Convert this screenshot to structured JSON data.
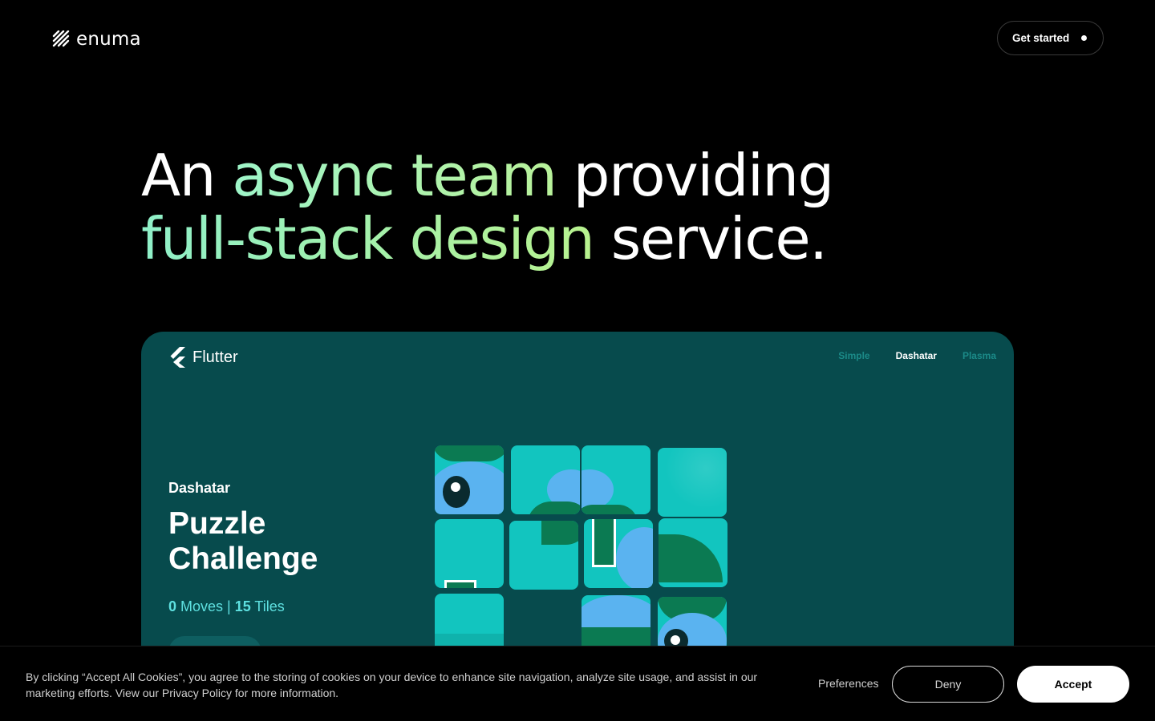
{
  "nav": {
    "logo_text": "enuma",
    "cta_label": "Get started"
  },
  "hero": {
    "line1_a": "An ",
    "line1_b": "async team",
    "line1_c": " providing",
    "line2_a": "full-stack design",
    "line2_b": " service."
  },
  "card": {
    "brand": "Flutter",
    "tabs": [
      "Simple",
      "Dashatar",
      "Plasma"
    ],
    "active_tab": "Dashatar",
    "theme_name": "Dashatar",
    "title": "Puzzle Challenge",
    "moves_count": "0",
    "moves_label": " Moves | ",
    "tiles_count": "15",
    "tiles_label": " Tiles"
  },
  "cookie": {
    "text": "By clicking “Accept All Cookies”, you agree to the storing of cookies on your device to enhance site navigation, analyze site usage, and assist in our marketing efforts. View our Privacy Policy for more information.",
    "preferences_label": "Preferences",
    "deny_label": "Deny",
    "accept_label": "Accept"
  },
  "colors": {
    "background": "#000000",
    "card": "#074b4d",
    "tile": "#12c5bf",
    "accent_green": "#b8f28e",
    "accent_mint": "#8ff0c9"
  }
}
